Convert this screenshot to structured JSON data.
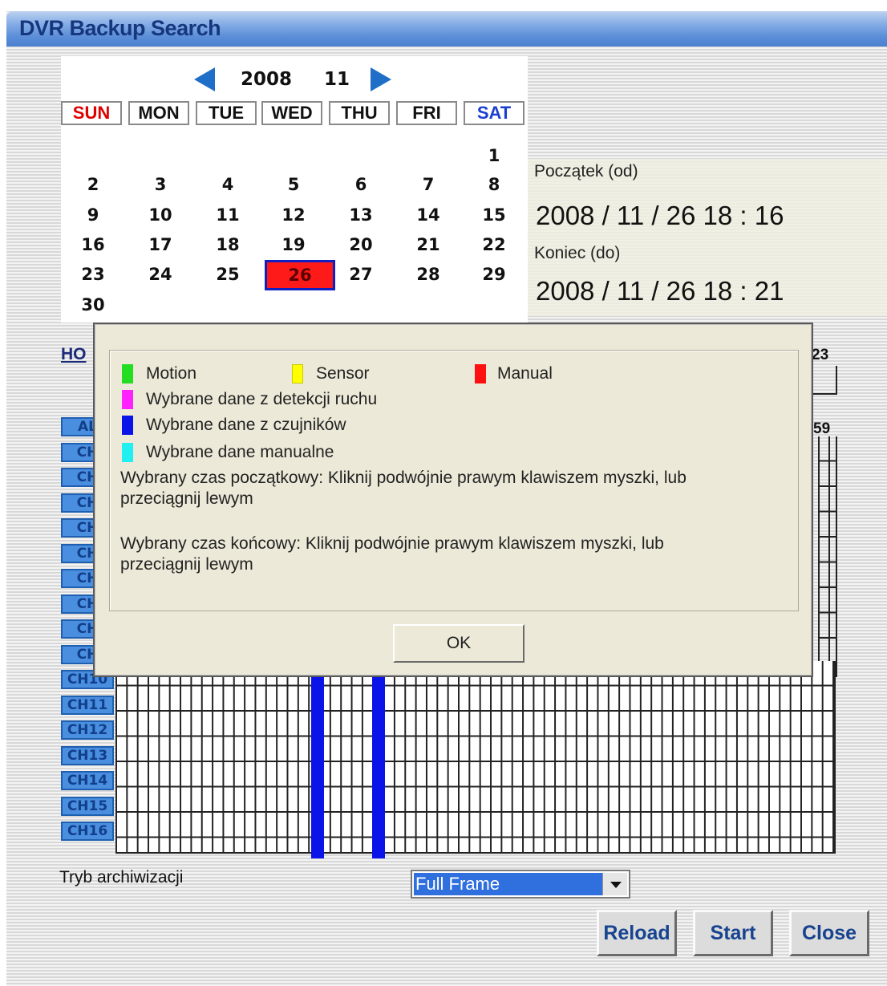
{
  "window": {
    "title": "DVR Backup Search"
  },
  "calendar": {
    "year": "2008",
    "month": "11",
    "weekdays": [
      "SUN",
      "MON",
      "TUE",
      "WED",
      "THU",
      "FRI",
      "SAT"
    ],
    "days": [
      "1",
      "2",
      "3",
      "4",
      "5",
      "6",
      "7",
      "8",
      "9",
      "10",
      "11",
      "12",
      "13",
      "14",
      "15",
      "16",
      "17",
      "18",
      "19",
      "20",
      "21",
      "22",
      "23",
      "24",
      "25",
      "26",
      "27",
      "28",
      "29",
      "30"
    ],
    "selected_day": "26"
  },
  "range": {
    "start_label": "Początek (od)",
    "start_time": "2008 / 11 / 26 18 : 16",
    "end_label": "Koniec (do)",
    "end_time": "2008 / 11 / 26 18 : 21"
  },
  "timeline": {
    "hour_label_partial": "HO",
    "hour_end": "23",
    "minute_end": "59",
    "all_partial": "AL",
    "channels": [
      "CH",
      "CH",
      "CH",
      "CH",
      "CH",
      "CH",
      "CH",
      "CH",
      "CH",
      "CH10",
      "CH11",
      "CH12",
      "CH13",
      "CH14",
      "CH15",
      "CH16"
    ]
  },
  "colors": {
    "motion": "#22dd22",
    "sensor": "#ffff00",
    "manual": "#ff1010",
    "selected_motion": "#ff22ff",
    "selected_sensor": "#0a14e8",
    "selected_manual": "#22f0f0"
  },
  "dialog": {
    "legend_motion": "Motion",
    "legend_sensor": "Sensor",
    "legend_manual": "Manual",
    "legend_sel_motion": "Wybrane dane z detekcji ruchu",
    "legend_sel_sensor": "Wybrane dane z czujników",
    "legend_sel_manual": "Wybrane dane manualne",
    "start_help_1": "Wybrany czas początkowy: Kliknij podwójnie prawym klawiszem myszki, lub",
    "start_help_2": "przeciągnij lewym",
    "end_help_1": "Wybrany czas końcowy: Kliknij podwójnie prawym klawiszem myszki, lub",
    "end_help_2": "przeciągnij lewym",
    "ok_label": "OK"
  },
  "bottom": {
    "mode_label": "Tryb archiwizacji",
    "mode_value": "Full Frame",
    "reload": "Reload",
    "start": "Start",
    "close": "Close"
  }
}
